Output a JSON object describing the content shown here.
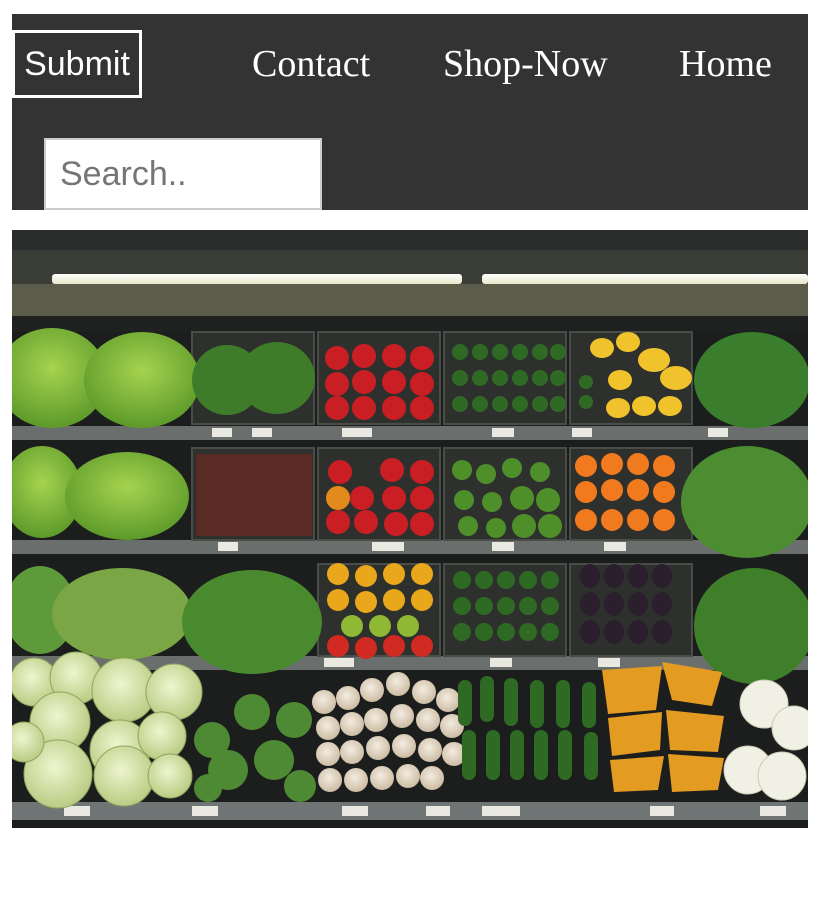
{
  "navbar": {
    "submit_label": "Submit",
    "links": [
      "Contact",
      "Shop-Now",
      "Home"
    ],
    "search_placeholder": "Search.."
  },
  "colors": {
    "navbar_bg": "#333333",
    "text": "#ffffff",
    "page_bg": "#ffffff"
  },
  "hero": {
    "subject": "produce-shelves-photo"
  }
}
